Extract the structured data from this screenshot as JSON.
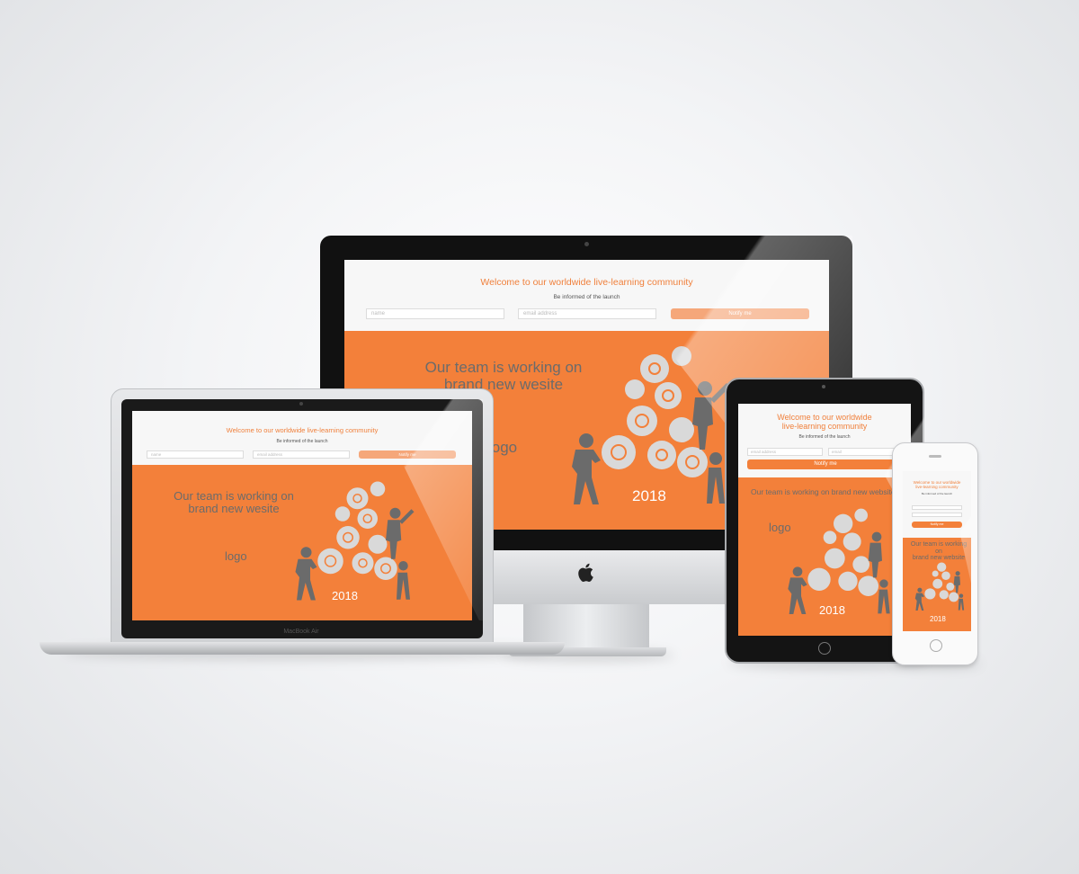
{
  "devices": {
    "imac": {
      "welcome": "Welcome to our worldwide live-learning community",
      "informed": "Be informed of the launch",
      "name_placeholder": "name",
      "email_placeholder": "email address",
      "notify": "Notify me",
      "heading_line1": "Our team is working on",
      "heading_line2": "brand new wesite",
      "logo": "logo",
      "year": "2018"
    },
    "macbook": {
      "welcome": "Welcome to our worldwide live-learning community",
      "informed": "Be informed of the launch",
      "name_placeholder": "name",
      "email_placeholder": "email address",
      "notify": "Notify me",
      "heading_line1": "Our team is working on",
      "heading_line2": "brand new wesite",
      "logo": "logo",
      "year": "2018",
      "brand_label": "MacBook Air"
    },
    "ipad": {
      "welcome_line1": "Welcome to our worldwide",
      "welcome_line2": "live-learning community",
      "informed": "Be informed of the launch",
      "name_placeholder": "email address",
      "email_placeholder": "email",
      "notify": "Notify me",
      "heading_line1": "Our team is working on brand new website",
      "logo": "logo",
      "year": "2018"
    },
    "iphone": {
      "welcome_line1": "Welcome to our worldwide",
      "welcome_line2": "live-learning community",
      "informed": "Be informed of the launch",
      "notify": "Notify me",
      "heading_line1": "Our team is working on",
      "heading_line2": "brand new website",
      "year": "2018"
    }
  },
  "colors": {
    "accent": "#f3803a",
    "button": "#f5a77a",
    "figure": "#6b6b6b",
    "gear": "#d9d9d9"
  }
}
